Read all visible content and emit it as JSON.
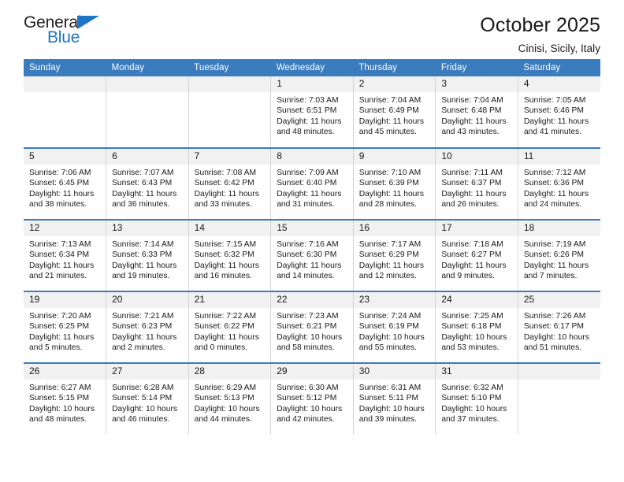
{
  "logo": {
    "word_top": "General",
    "word_bottom": "Blue",
    "accent_color": "#1c76c5"
  },
  "header": {
    "title": "October 2025",
    "subtitle": "Cinisi, Sicily, Italy"
  },
  "theme": {
    "header_row_bg": "#3a7cbe",
    "daynum_bg": "#f1f1f1",
    "text": "#1a1a1a"
  },
  "weekday_headers": [
    "Sunday",
    "Monday",
    "Tuesday",
    "Wednesday",
    "Thursday",
    "Friday",
    "Saturday"
  ],
  "weeks": [
    [
      {
        "day": "",
        "empty": true
      },
      {
        "day": "",
        "empty": true
      },
      {
        "day": "",
        "empty": true
      },
      {
        "day": "1",
        "sunrise": "Sunrise: 7:03 AM",
        "sunset": "Sunset: 6:51 PM",
        "daylight": "Daylight: 11 hours and 48 minutes."
      },
      {
        "day": "2",
        "sunrise": "Sunrise: 7:04 AM",
        "sunset": "Sunset: 6:49 PM",
        "daylight": "Daylight: 11 hours and 45 minutes."
      },
      {
        "day": "3",
        "sunrise": "Sunrise: 7:04 AM",
        "sunset": "Sunset: 6:48 PM",
        "daylight": "Daylight: 11 hours and 43 minutes."
      },
      {
        "day": "4",
        "sunrise": "Sunrise: 7:05 AM",
        "sunset": "Sunset: 6:46 PM",
        "daylight": "Daylight: 11 hours and 41 minutes."
      }
    ],
    [
      {
        "day": "5",
        "sunrise": "Sunrise: 7:06 AM",
        "sunset": "Sunset: 6:45 PM",
        "daylight": "Daylight: 11 hours and 38 minutes."
      },
      {
        "day": "6",
        "sunrise": "Sunrise: 7:07 AM",
        "sunset": "Sunset: 6:43 PM",
        "daylight": "Daylight: 11 hours and 36 minutes."
      },
      {
        "day": "7",
        "sunrise": "Sunrise: 7:08 AM",
        "sunset": "Sunset: 6:42 PM",
        "daylight": "Daylight: 11 hours and 33 minutes."
      },
      {
        "day": "8",
        "sunrise": "Sunrise: 7:09 AM",
        "sunset": "Sunset: 6:40 PM",
        "daylight": "Daylight: 11 hours and 31 minutes."
      },
      {
        "day": "9",
        "sunrise": "Sunrise: 7:10 AM",
        "sunset": "Sunset: 6:39 PM",
        "daylight": "Daylight: 11 hours and 28 minutes."
      },
      {
        "day": "10",
        "sunrise": "Sunrise: 7:11 AM",
        "sunset": "Sunset: 6:37 PM",
        "daylight": "Daylight: 11 hours and 26 minutes."
      },
      {
        "day": "11",
        "sunrise": "Sunrise: 7:12 AM",
        "sunset": "Sunset: 6:36 PM",
        "daylight": "Daylight: 11 hours and 24 minutes."
      }
    ],
    [
      {
        "day": "12",
        "sunrise": "Sunrise: 7:13 AM",
        "sunset": "Sunset: 6:34 PM",
        "daylight": "Daylight: 11 hours and 21 minutes."
      },
      {
        "day": "13",
        "sunrise": "Sunrise: 7:14 AM",
        "sunset": "Sunset: 6:33 PM",
        "daylight": "Daylight: 11 hours and 19 minutes."
      },
      {
        "day": "14",
        "sunrise": "Sunrise: 7:15 AM",
        "sunset": "Sunset: 6:32 PM",
        "daylight": "Daylight: 11 hours and 16 minutes."
      },
      {
        "day": "15",
        "sunrise": "Sunrise: 7:16 AM",
        "sunset": "Sunset: 6:30 PM",
        "daylight": "Daylight: 11 hours and 14 minutes."
      },
      {
        "day": "16",
        "sunrise": "Sunrise: 7:17 AM",
        "sunset": "Sunset: 6:29 PM",
        "daylight": "Daylight: 11 hours and 12 minutes."
      },
      {
        "day": "17",
        "sunrise": "Sunrise: 7:18 AM",
        "sunset": "Sunset: 6:27 PM",
        "daylight": "Daylight: 11 hours and 9 minutes."
      },
      {
        "day": "18",
        "sunrise": "Sunrise: 7:19 AM",
        "sunset": "Sunset: 6:26 PM",
        "daylight": "Daylight: 11 hours and 7 minutes."
      }
    ],
    [
      {
        "day": "19",
        "sunrise": "Sunrise: 7:20 AM",
        "sunset": "Sunset: 6:25 PM",
        "daylight": "Daylight: 11 hours and 5 minutes."
      },
      {
        "day": "20",
        "sunrise": "Sunrise: 7:21 AM",
        "sunset": "Sunset: 6:23 PM",
        "daylight": "Daylight: 11 hours and 2 minutes."
      },
      {
        "day": "21",
        "sunrise": "Sunrise: 7:22 AM",
        "sunset": "Sunset: 6:22 PM",
        "daylight": "Daylight: 11 hours and 0 minutes."
      },
      {
        "day": "22",
        "sunrise": "Sunrise: 7:23 AM",
        "sunset": "Sunset: 6:21 PM",
        "daylight": "Daylight: 10 hours and 58 minutes."
      },
      {
        "day": "23",
        "sunrise": "Sunrise: 7:24 AM",
        "sunset": "Sunset: 6:19 PM",
        "daylight": "Daylight: 10 hours and 55 minutes."
      },
      {
        "day": "24",
        "sunrise": "Sunrise: 7:25 AM",
        "sunset": "Sunset: 6:18 PM",
        "daylight": "Daylight: 10 hours and 53 minutes."
      },
      {
        "day": "25",
        "sunrise": "Sunrise: 7:26 AM",
        "sunset": "Sunset: 6:17 PM",
        "daylight": "Daylight: 10 hours and 51 minutes."
      }
    ],
    [
      {
        "day": "26",
        "sunrise": "Sunrise: 6:27 AM",
        "sunset": "Sunset: 5:15 PM",
        "daylight": "Daylight: 10 hours and 48 minutes."
      },
      {
        "day": "27",
        "sunrise": "Sunrise: 6:28 AM",
        "sunset": "Sunset: 5:14 PM",
        "daylight": "Daylight: 10 hours and 46 minutes."
      },
      {
        "day": "28",
        "sunrise": "Sunrise: 6:29 AM",
        "sunset": "Sunset: 5:13 PM",
        "daylight": "Daylight: 10 hours and 44 minutes."
      },
      {
        "day": "29",
        "sunrise": "Sunrise: 6:30 AM",
        "sunset": "Sunset: 5:12 PM",
        "daylight": "Daylight: 10 hours and 42 minutes."
      },
      {
        "day": "30",
        "sunrise": "Sunrise: 6:31 AM",
        "sunset": "Sunset: 5:11 PM",
        "daylight": "Daylight: 10 hours and 39 minutes."
      },
      {
        "day": "31",
        "sunrise": "Sunrise: 6:32 AM",
        "sunset": "Sunset: 5:10 PM",
        "daylight": "Daylight: 10 hours and 37 minutes."
      },
      {
        "day": "",
        "empty": true
      }
    ]
  ]
}
